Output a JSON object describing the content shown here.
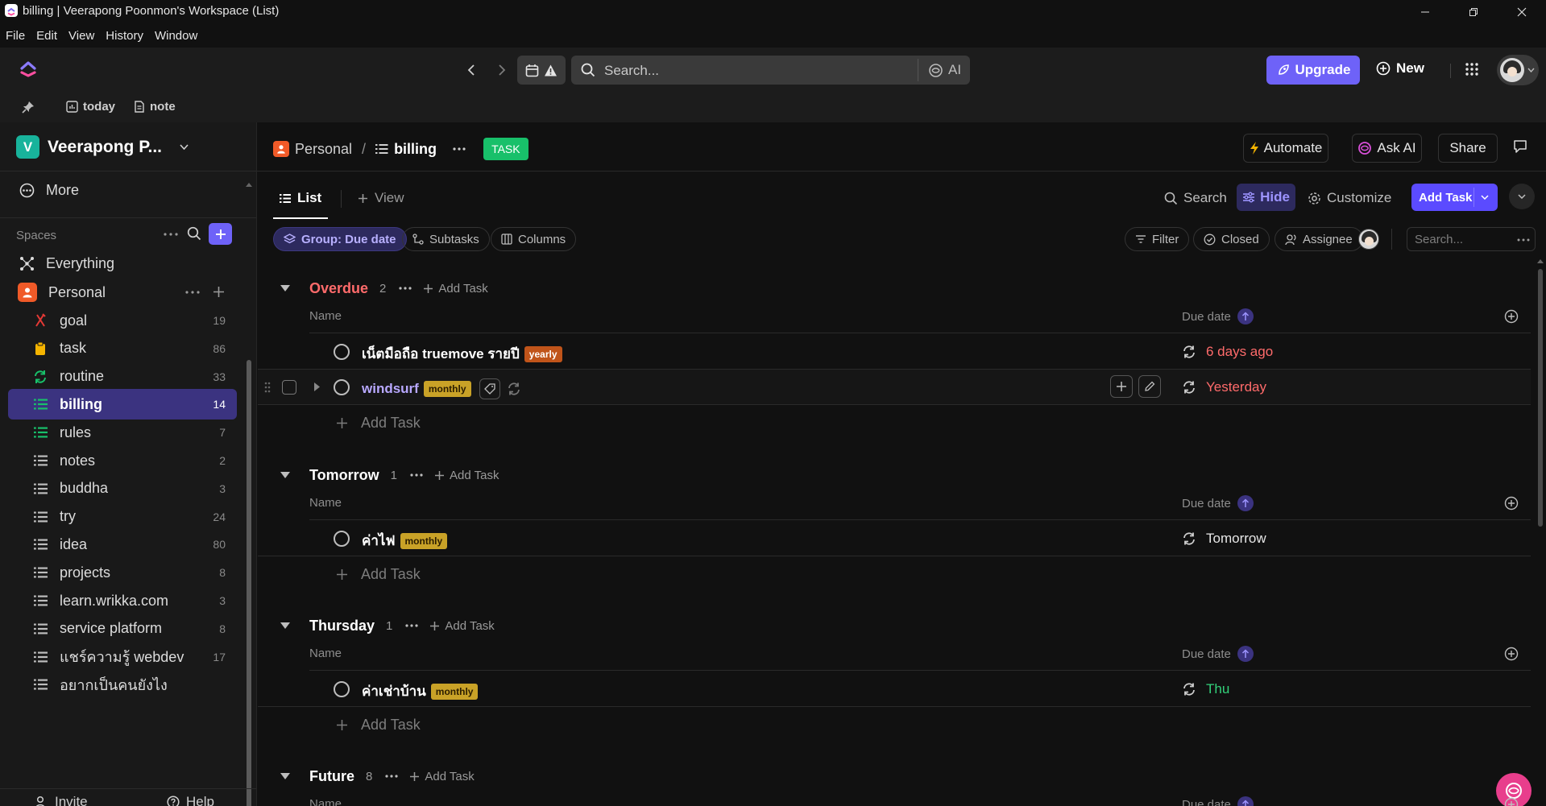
{
  "window": {
    "title": "billing | Veerapong Poonmon's Workspace (List)"
  },
  "menu": [
    "File",
    "Edit",
    "View",
    "History",
    "Window"
  ],
  "topbar": {
    "search_placeholder": "Search...",
    "ai_label": "AI",
    "upgrade_label": "Upgrade",
    "new_label": "New"
  },
  "favorites": [
    {
      "label": "today",
      "icon": "chart-icon"
    },
    {
      "label": "note",
      "icon": "doc-icon"
    }
  ],
  "sidebar": {
    "workspace_initial": "V",
    "workspace_name": "Veerapong P...",
    "more_label": "More",
    "spaces_label": "Spaces",
    "everything_label": "Everything",
    "personal_label": "Personal",
    "items": [
      {
        "label": "goal",
        "count": "19",
        "icon": "goal-icon",
        "color": "#e53935"
      },
      {
        "label": "task",
        "count": "86",
        "icon": "clipboard-icon",
        "color": "#f5b400"
      },
      {
        "label": "routine",
        "count": "33",
        "icon": "refresh-icon",
        "color": "#18c06a"
      },
      {
        "label": "billing",
        "count": "14",
        "icon": "list-icon",
        "color": "#18c06a",
        "active": true
      },
      {
        "label": "rules",
        "count": "7",
        "icon": "list-icon",
        "color": "#18c06a"
      },
      {
        "label": "notes",
        "count": "2",
        "icon": "list-icon",
        "color": "#bdbdbd"
      },
      {
        "label": "buddha",
        "count": "3",
        "icon": "list-icon",
        "color": "#bdbdbd"
      },
      {
        "label": "try",
        "count": "24",
        "icon": "list-icon",
        "color": "#bdbdbd"
      },
      {
        "label": "idea",
        "count": "80",
        "icon": "list-icon",
        "color": "#bdbdbd"
      },
      {
        "label": "projects",
        "count": "8",
        "icon": "list-icon",
        "color": "#bdbdbd"
      },
      {
        "label": "learn.wrikka.com",
        "count": "3",
        "icon": "list-icon",
        "color": "#bdbdbd"
      },
      {
        "label": "service platform",
        "count": "8",
        "icon": "list-icon",
        "color": "#bdbdbd"
      },
      {
        "label": "แชร์ความรู้ webdev",
        "count": "17",
        "icon": "list-icon",
        "color": "#bdbdbd"
      },
      {
        "label": "อยากเป็นคนยังไง",
        "count": "",
        "icon": "list-icon",
        "color": "#bdbdbd"
      }
    ],
    "invite_label": "Invite",
    "help_label": "Help"
  },
  "header": {
    "space": "Personal",
    "list": "billing",
    "badge": "TASK",
    "automate": "Automate",
    "ask_ai": "Ask AI",
    "share": "Share"
  },
  "views": {
    "list_tab": "List",
    "add_view": "View",
    "search": "Search",
    "hide": "Hide",
    "customize": "Customize",
    "add_task": "Add Task"
  },
  "filters": {
    "group": "Group: Due date",
    "subtasks": "Subtasks",
    "columns": "Columns",
    "filter": "Filter",
    "closed": "Closed",
    "assignee": "Assignee",
    "search_placeholder": "Search..."
  },
  "table": {
    "name_col": "Name",
    "due_col": "Due date",
    "add_task": "Add Task"
  },
  "groups": [
    {
      "name": "Overdue",
      "count": "2",
      "color": "#ff6b6b",
      "tasks": [
        {
          "name": "เน็ตมือถือ truemove รายปี",
          "tag": "yearly",
          "tag_color": "#c0541a",
          "due": "6 days ago",
          "due_color": "#ff6b6b"
        },
        {
          "name": "windsurf",
          "tag": "monthly",
          "tag_color": "#c9a227",
          "due": "Yesterday",
          "due_color": "#ff6b6b"
        }
      ]
    },
    {
      "name": "Tomorrow",
      "count": "1",
      "color": "#ffffff",
      "tasks": [
        {
          "name": "ค่าไฟ",
          "tag": "monthly",
          "tag_color": "#c9a227",
          "due": "Tomorrow",
          "due_color": "#e6e6e6"
        }
      ]
    },
    {
      "name": "Thursday",
      "count": "1",
      "color": "#ffffff",
      "tasks": [
        {
          "name": "ค่าเช่าบ้าน",
          "tag": "monthly",
          "tag_color": "#c9a227",
          "due": "Thu",
          "due_color": "#33d17a"
        }
      ]
    },
    {
      "name": "Future",
      "count": "8",
      "color": "#ffffff",
      "tasks": []
    }
  ],
  "colors": {
    "accent": "#7b68ee",
    "add_task_btn": "#5b4bff",
    "badge": "#18c06a"
  }
}
